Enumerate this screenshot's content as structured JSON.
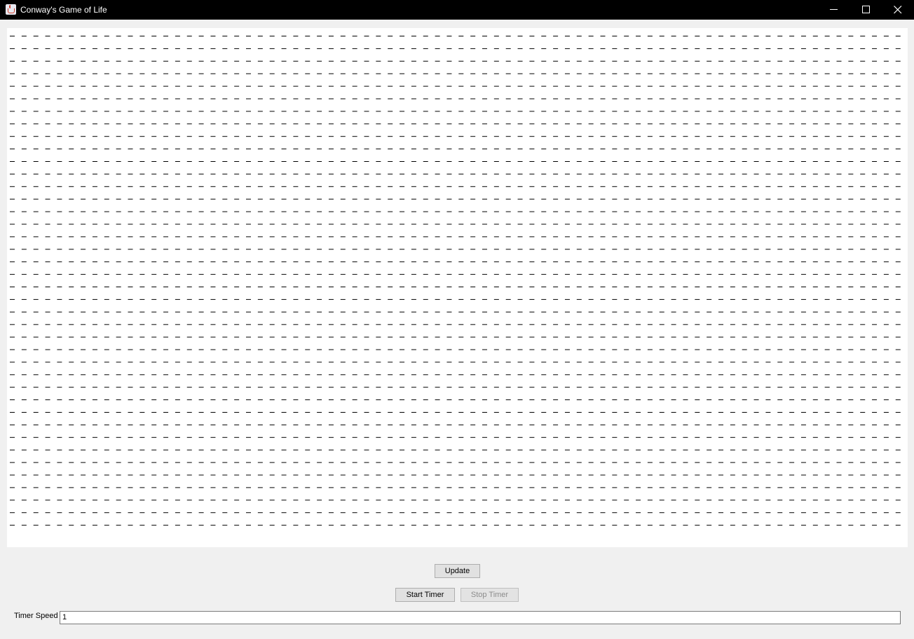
{
  "window": {
    "title": "Conway's Game of Life"
  },
  "board": {
    "rows": 40,
    "cols": 76,
    "dead_cell_symbol": "-",
    "alive_cell_symbol": "*",
    "alive_cells": []
  },
  "controls": {
    "update_label": "Update",
    "start_timer_label": "Start Timer",
    "stop_timer_label": "Stop Timer",
    "stop_timer_enabled": false,
    "timer_speed_label": "Timer Speed",
    "timer_speed_value": "1"
  },
  "icons": {
    "app": "java-icon",
    "minimize": "minimize-icon",
    "maximize": "maximize-icon",
    "close": "close-icon"
  },
  "colors": {
    "titlebar": "#000000",
    "board_background": "#ffffff",
    "window_background": "#f0f0f0",
    "cell_dash": "#000000"
  }
}
